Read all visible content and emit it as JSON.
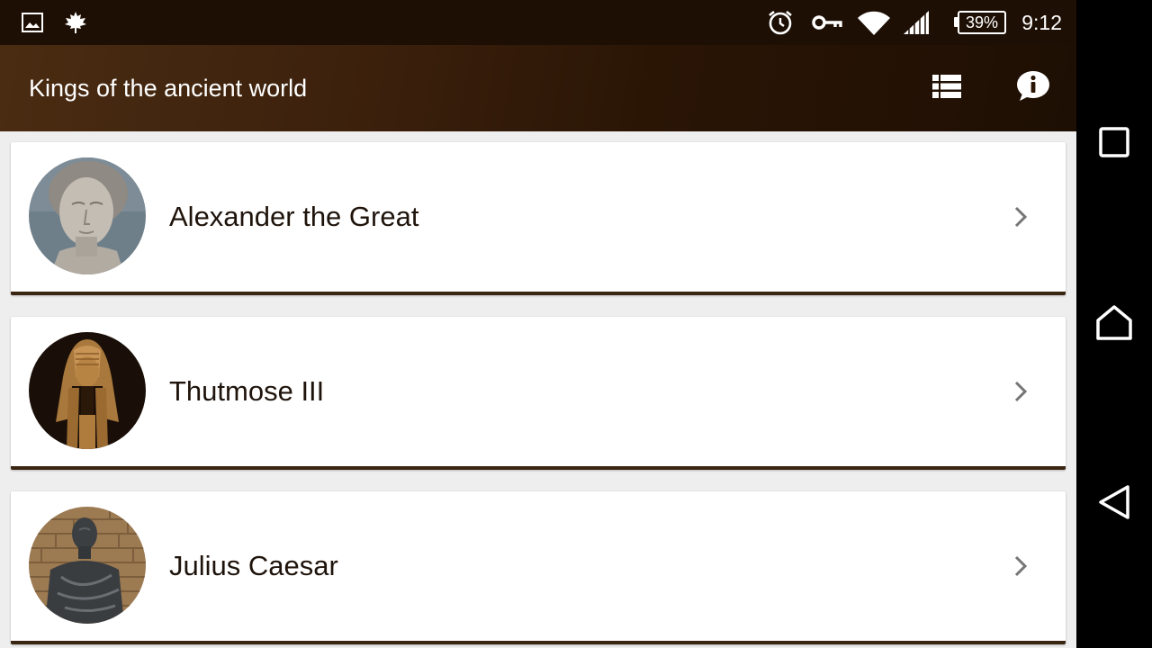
{
  "status_bar": {
    "icons_left": [
      "gallery-icon",
      "maple-leaf-icon"
    ],
    "icons_right": [
      "alarm-icon",
      "vpn-key-icon",
      "wifi-icon",
      "signal-icon"
    ],
    "battery": "39%",
    "time": "9:12"
  },
  "app_bar": {
    "title": "Kings of the ancient world",
    "actions": [
      "list-view-icon",
      "info-icon"
    ],
    "colors": {
      "dark": "#1e0f04",
      "light": "#4a2c12"
    }
  },
  "kings": [
    {
      "name": "Alexander the Great",
      "icon": "chevron-right-icon"
    },
    {
      "name": "Thutmose III",
      "icon": "chevron-right-icon"
    },
    {
      "name": "Julius Caesar",
      "icon": "chevron-right-icon"
    }
  ],
  "card_accent_color": "#3a2412",
  "nav_bar": {
    "buttons": [
      "recents-square-icon",
      "home-icon",
      "back-triangle-icon"
    ]
  }
}
